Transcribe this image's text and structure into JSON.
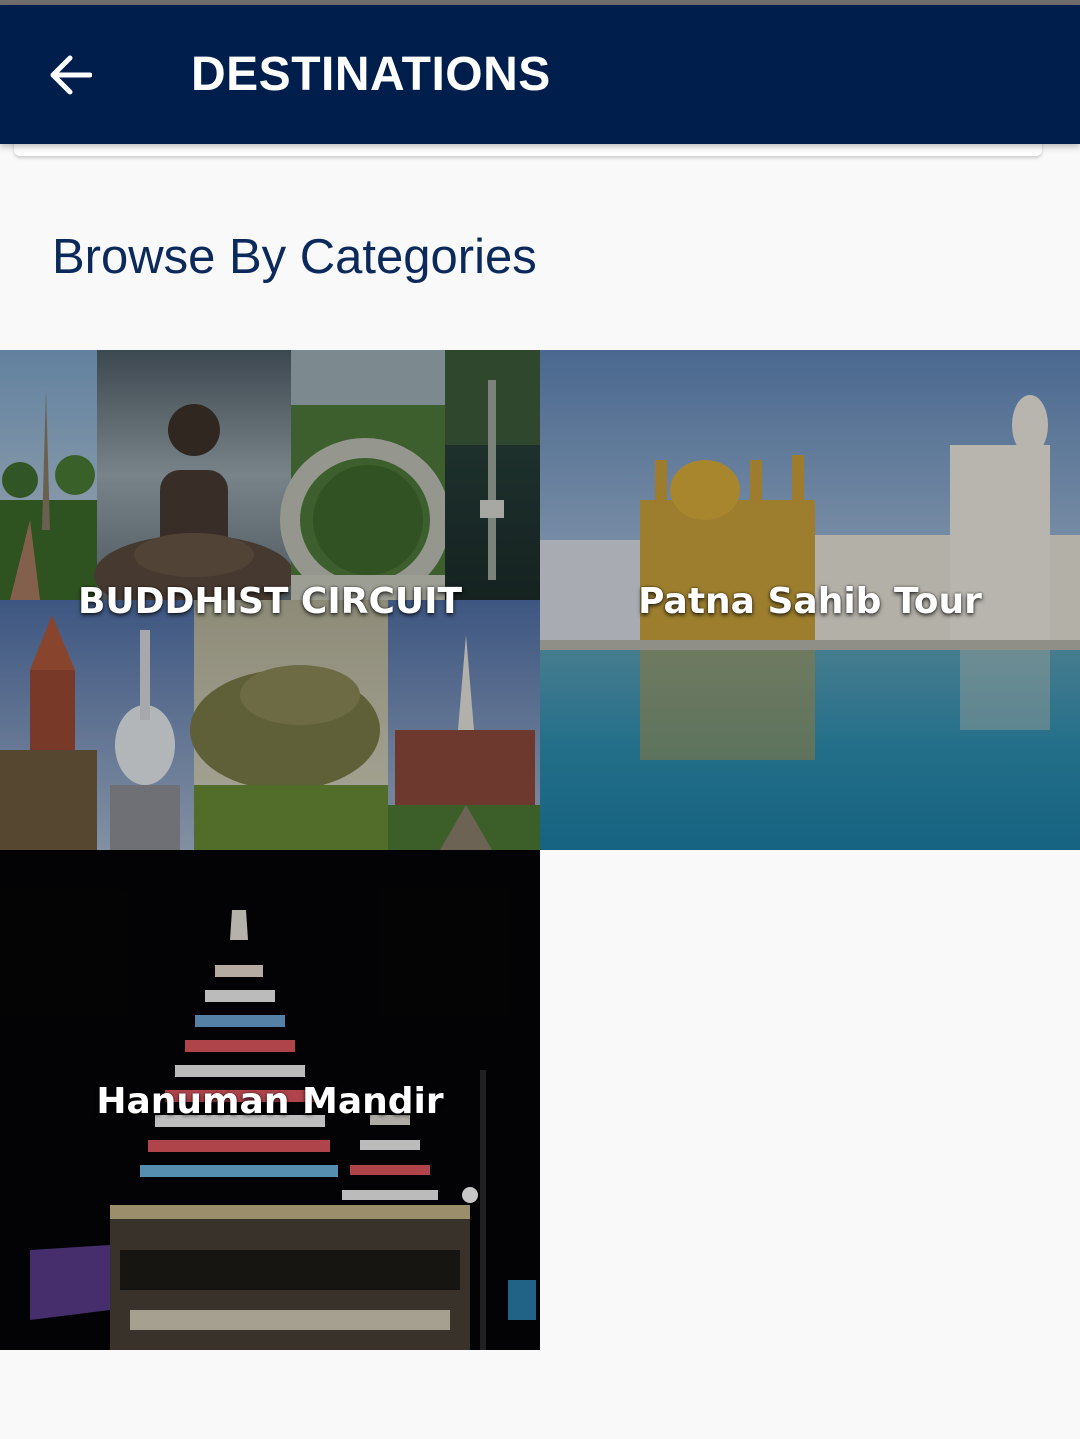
{
  "app_bar": {
    "title": "DESTINATIONS",
    "back_icon": "arrow-left-icon",
    "background": "#001e4b"
  },
  "section": {
    "heading": "Browse By Categories",
    "heading_color": "#0b2a5b"
  },
  "categories": [
    {
      "label": "BUDDHIST CIRCUIT",
      "image": "collage-of-buddhist-sites"
    },
    {
      "label": "Patna Sahib Tour",
      "image": "golden-temple-over-water"
    },
    {
      "label": "Hanuman Mandir",
      "image": "illuminated-temple-at-night"
    }
  ]
}
